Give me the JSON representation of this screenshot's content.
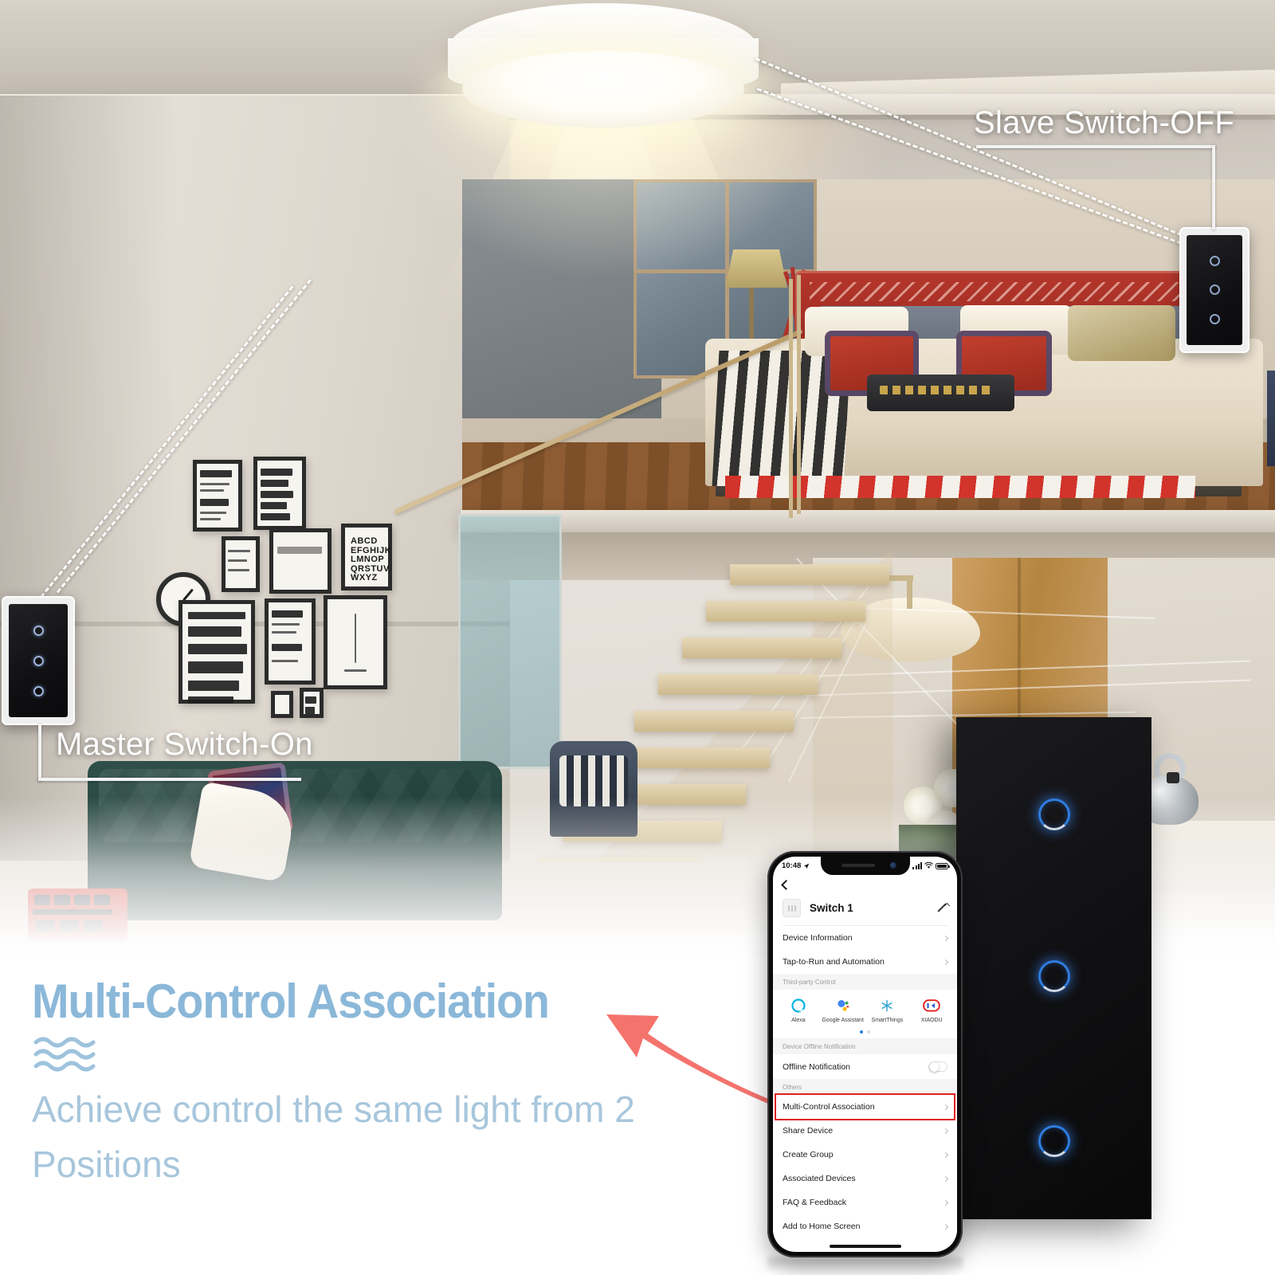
{
  "callouts": {
    "slave": "Slave Switch-OFF",
    "master": "Master Switch-On"
  },
  "marketing": {
    "headline": "Multi-Control Association",
    "subline": "Achieve control the same light from 2 Positions",
    "headline_color": "#8bb8d9",
    "subline_color": "#a7c6dc",
    "arrow_color": "#f4736d",
    "wave_icon": "waves-icon"
  },
  "phone": {
    "status": {
      "time": "10:48",
      "location_icon": "location-arrow-icon",
      "signal_icon": "cellular-bars-icon",
      "wifi_icon": "wifi-icon",
      "battery_icon": "battery-full-icon"
    },
    "nav": {
      "back_icon": "back-chevron-icon"
    },
    "device": {
      "icon": "switch-device-icon",
      "name": "Switch 1",
      "edit_icon": "pencil-edit-icon"
    },
    "rows_top": [
      {
        "label": "Device Information"
      },
      {
        "label": "Tap-to-Run and Automation"
      }
    ],
    "third_party": {
      "section": "Third-party Control",
      "items": [
        {
          "label": "Alexa",
          "icon": "alexa-icon",
          "color": "#00b4e0"
        },
        {
          "label": "Google Assistant",
          "icon": "google-assistant-icon",
          "color": "#4285f4"
        },
        {
          "label": "SmartThings",
          "icon": "smartthings-icon",
          "color": "#3fa9d6"
        },
        {
          "label": "XIAODU",
          "icon": "xiaodu-icon",
          "color": "#e02020"
        }
      ],
      "page_dots": 2,
      "active_dot": 1
    },
    "offline": {
      "section": "Device Offline Notification",
      "label": "Offline Notification",
      "toggle_state": "off"
    },
    "others": {
      "section": "Others",
      "rows": [
        {
          "label": "Multi-Control Association",
          "highlighted": true
        },
        {
          "label": "Share Device",
          "highlighted": false
        },
        {
          "label": "Create Group",
          "highlighted": false
        },
        {
          "label": "Associated Devices",
          "highlighted": false
        },
        {
          "label": "FAQ & Feedback",
          "highlighted": false
        },
        {
          "label": "Add to Home Screen",
          "highlighted": false
        }
      ],
      "highlight_color": "#e02020"
    }
  },
  "devices": {
    "master_switch": {
      "name": "master-wall-switch",
      "state": "on",
      "buttons": 3
    },
    "slave_switch": {
      "name": "slave-wall-switch",
      "state": "off",
      "buttons": 3
    },
    "foreground_switch": {
      "name": "foreground-touch-panel",
      "buttons": 3,
      "indicator_color": "#2f7de0"
    },
    "ceiling_lamp": {
      "name": "ceiling-lamp",
      "state": "on"
    }
  }
}
